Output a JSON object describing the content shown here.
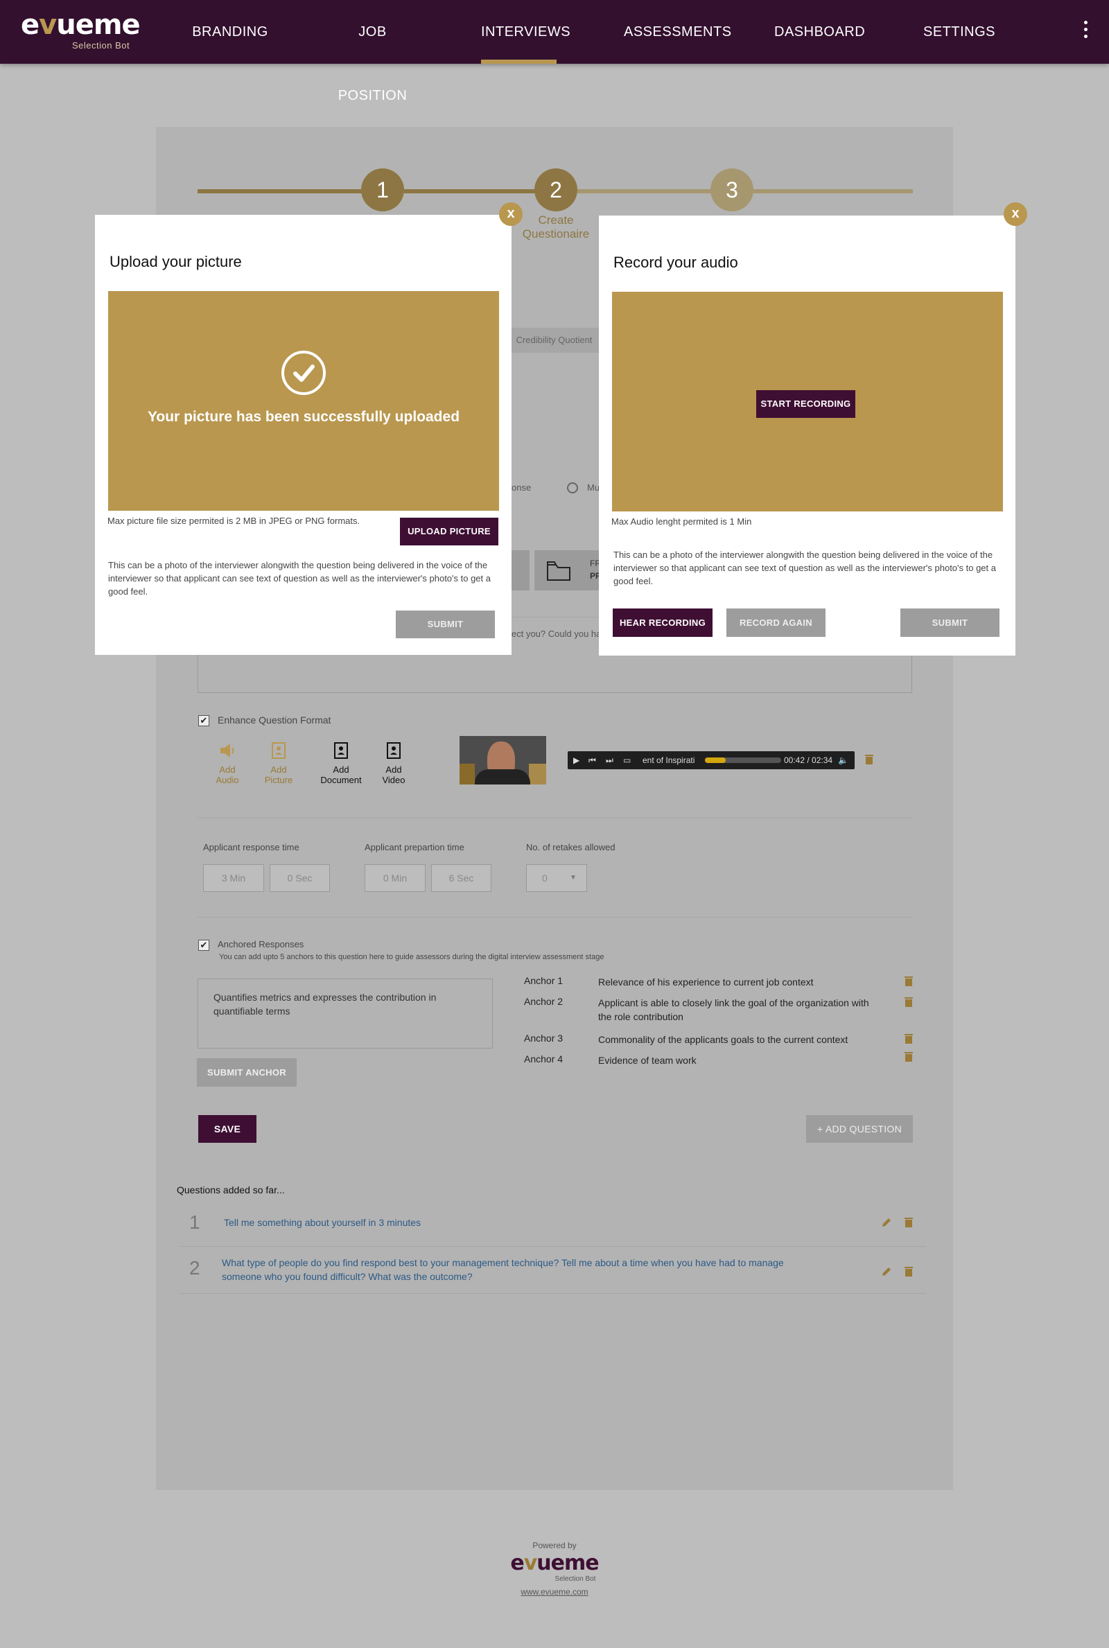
{
  "nav": {
    "logo_left": "e",
    "logo_v": "v",
    "logo_right": "ueme",
    "logo_sub": "Selection Bot",
    "items": [
      "BRANDING",
      "JOB POSITION",
      "INTERVIEWS",
      "ASSESSMENTS",
      "DASHBOARD",
      "SETTINGS"
    ],
    "active_item": "INTERVIEWS"
  },
  "stepper": {
    "steps": [
      "1",
      "2",
      "3"
    ],
    "active_label_line1": "Create",
    "active_label_line2": "Questionaire"
  },
  "background_form": {
    "tab_label": "Credibility Quotient",
    "radio_response": "onse",
    "radio_other": "Mu",
    "question_snippet": "ect you? Could you ha",
    "folder_label_1": "FR",
    "folder_label_2": "PR",
    "enhance_label": "Enhance Question Format",
    "media": [
      {
        "line1": "Add",
        "line2": "Audio"
      },
      {
        "line1": "Add",
        "line2": "Picture"
      },
      {
        "line1": "Add",
        "line2": "Document"
      },
      {
        "line1": "Add",
        "line2": "Video"
      }
    ],
    "player": {
      "title": "ent of Inspirati",
      "time": "00:42 / 02:34",
      "progress_fraction": 0.27
    },
    "timing": {
      "response_label": "Applicant response time",
      "response_min": "3  Min",
      "response_sec": "0 Sec",
      "prep_label": "Applicant prepartion time",
      "prep_min": "0  Min",
      "prep_sec": "6 Sec",
      "retakes_label": "No. of retakes allowed",
      "retakes_value": "0"
    },
    "anchored": {
      "label": "Anchored Responses",
      "hint": "You can add upto 5 anchors to this question here to guide assessors during the digital interview assessment stage",
      "input_text": "Quantifies metrics and expresses the contribution in quantifiable terms",
      "submit_label": "SUBMIT ANCHOR",
      "anchors": [
        {
          "name": "Anchor 1",
          "text": "Relevance of his experience to current job context"
        },
        {
          "name": "Anchor 2",
          "text": "Applicant is able to closely link the goal of the organization with the role contribution"
        },
        {
          "name": "Anchor 3",
          "text": "Commonality of the applicants goals to the current context"
        },
        {
          "name": "Anchor 4",
          "text": "Evidence of  team work"
        }
      ]
    },
    "save_label": "SAVE",
    "add_question_label": "+ ADD QUESTION",
    "questions_heading": "Questions added so far...",
    "questions": [
      {
        "num": "1",
        "text": "Tell me something about yourself in 3 minutes"
      },
      {
        "num": "2",
        "text": "What type of people do you find respond best to your management technique? Tell me about a time when you have had to manage someone who you found difficult? What was the outcome?"
      }
    ]
  },
  "footer": {
    "powered_by": "Powered by",
    "logo_e": "e",
    "logo_v": "v",
    "logo_rest": "ueme",
    "logo_sub": "Selection Bot",
    "url": "www.evueme.com"
  },
  "upload_modal": {
    "close": "x",
    "title": "Upload your picture",
    "success_text": "Your picture has been successfully uploaded",
    "size_note": "Max picture file size permited is 2 MB in JPEG or PNG formats.",
    "upload_button": "UPLOAD PICTURE",
    "description": "This can be a photo of the interviewer alongwith the question being delivered in the voice of the interviewer so that applicant can see text of question as well as the interviewer's photo's to get a good feel.",
    "submit": "SUBMIT"
  },
  "audio_modal": {
    "close": "x",
    "title": "Record your audio",
    "start_button": "START RECORDING",
    "length_note": "Max Audio lenght permited is 1 Min",
    "description": "This can be a photo of the interviewer alongwith the question being delivered in the voice of the interviewer so that applicant can see text of question as well as the interviewer's photo's to get a good feel.",
    "hear_button": "HEAR RECORDING",
    "record_again_button": "RECORD AGAIN",
    "submit": "SUBMIT"
  },
  "colors": {
    "nav_bg": "#33102e",
    "gold": "#b9974f",
    "dark_button": "#3f0f33",
    "grey_button": "#9d9d9d",
    "overlay_bg": "#bdbdbd"
  }
}
